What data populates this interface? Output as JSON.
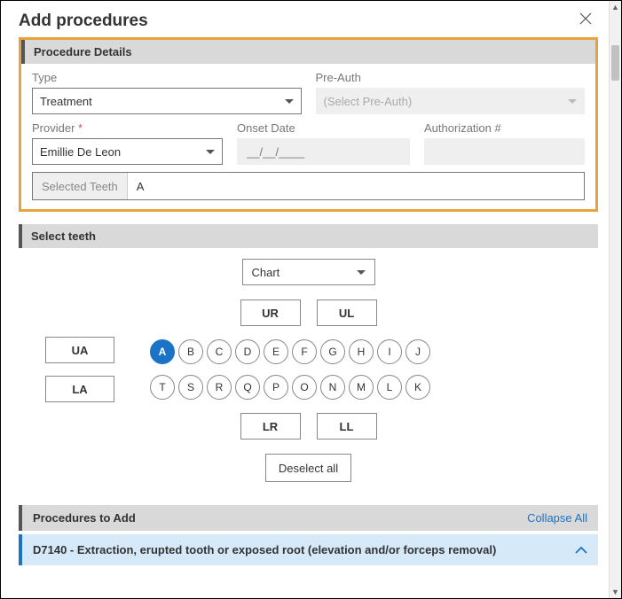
{
  "dialog": {
    "title": "Add procedures"
  },
  "details": {
    "section_label": "Procedure Details",
    "type_label": "Type",
    "type_value": "Treatment",
    "preauth_label": "Pre-Auth",
    "preauth_placeholder": "(Select Pre-Auth)",
    "provider_label": "Provider",
    "provider_value": "Emillie De Leon",
    "onset_label": "Onset Date",
    "onset_placeholder": "__/__/____",
    "auth_label": "Authorization #",
    "auth_value": "",
    "selected_teeth_label": "Selected Teeth",
    "selected_teeth_value": "A"
  },
  "teeth": {
    "section_label": "Select teeth",
    "chart_select": "Chart",
    "quads": [
      "UR",
      "UL",
      "LR",
      "LL"
    ],
    "arches": [
      "UA",
      "LA"
    ],
    "row_upper": [
      "A",
      "B",
      "C",
      "D",
      "E",
      "F",
      "G",
      "H",
      "I",
      "J"
    ],
    "row_lower": [
      "T",
      "S",
      "R",
      "Q",
      "P",
      "O",
      "N",
      "M",
      "L",
      "K"
    ],
    "selected": [
      "A"
    ],
    "deselect_label": "Deselect all"
  },
  "procs": {
    "section_label": "Procedures to Add",
    "collapse_label": "Collapse All",
    "items": [
      {
        "label": "D7140 - Extraction, erupted tooth or exposed root (elevation and/or forceps removal)"
      }
    ]
  }
}
